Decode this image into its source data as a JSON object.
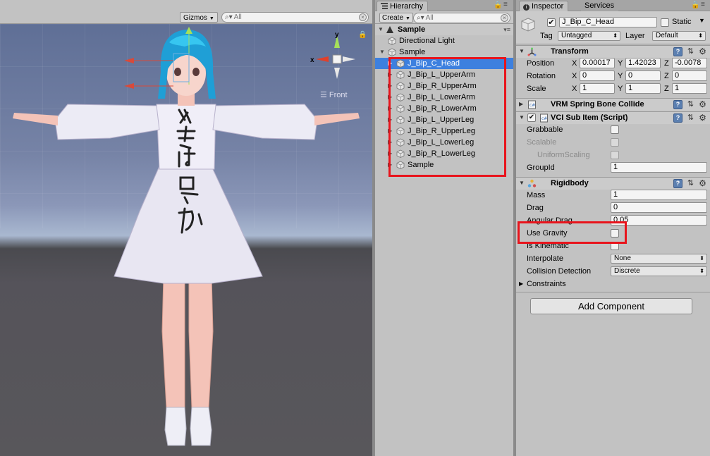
{
  "scene": {
    "gizmos_label": "Gizmos",
    "search_placeholder": "All",
    "axis_x_label": "x",
    "axis_y_label": "y",
    "view_label": "Front"
  },
  "hierarchy": {
    "tab_label": "Hierarchy",
    "create_label": "Create",
    "search_placeholder": "All",
    "scene_name": "Sample",
    "items": [
      {
        "label": "Directional Light"
      },
      {
        "label": "Sample"
      },
      {
        "label": "J_Bip_C_Head",
        "selected": true
      },
      {
        "label": "J_Bip_L_UpperArm"
      },
      {
        "label": "J_Bip_R_UpperArm"
      },
      {
        "label": "J_Bip_L_LowerArm"
      },
      {
        "label": "J_Bip_R_LowerArm"
      },
      {
        "label": "J_Bip_L_UpperLeg"
      },
      {
        "label": "J_Bip_R_UpperLeg"
      },
      {
        "label": "J_Bip_L_LowerLeg"
      },
      {
        "label": "J_Bip_R_LowerLeg"
      },
      {
        "label": "Sample"
      }
    ]
  },
  "inspector": {
    "tab_label": "Inspector",
    "services_label": "Services",
    "object_name": "J_Bip_C_Head",
    "active": true,
    "static_label": "Static",
    "tag_label": "Tag",
    "tag_value": "Untagged",
    "layer_label": "Layer",
    "layer_value": "Default",
    "transform": {
      "title": "Transform",
      "position_label": "Position",
      "rotation_label": "Rotation",
      "scale_label": "Scale",
      "x_label": "X",
      "y_label": "Y",
      "z_label": "Z",
      "position": {
        "x": "0.00017",
        "y": "1.42023",
        "z": "-0.0078"
      },
      "rotation": {
        "x": "0",
        "y": "0",
        "z": "0"
      },
      "scale": {
        "x": "1",
        "y": "1",
        "z": "1"
      }
    },
    "spring_bone": {
      "title": "VRM Spring Bone Collide"
    },
    "vci_sub_item": {
      "title": "VCI Sub Item (Script)",
      "grabbable_label": "Grabbable",
      "scalable_label": "Scalable",
      "uniform_scaling_label": "UniformScaling",
      "group_id_label": "GroupId",
      "group_id_value": "1"
    },
    "rigidbody": {
      "title": "Rigidbody",
      "mass_label": "Mass",
      "mass_value": "1",
      "drag_label": "Drag",
      "drag_value": "0",
      "angular_drag_label": "Angular Drag",
      "angular_drag_value": "0.05",
      "use_gravity_label": "Use Gravity",
      "is_kinematic_label": "Is Kinematic",
      "interpolate_label": "Interpolate",
      "interpolate_value": "None",
      "collision_label": "Collision Detection",
      "collision_value": "Discrete",
      "constraints_label": "Constraints"
    },
    "add_component_label": "Add Component"
  },
  "colors": {
    "highlight_red": "#e8141c",
    "selection_blue": "#3d80df",
    "panel_gray": "#c2c2c2"
  }
}
